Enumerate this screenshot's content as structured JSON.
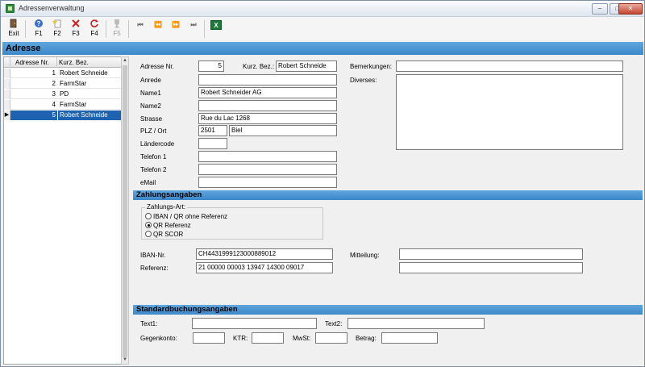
{
  "window": {
    "title": "Adressenverwaltung",
    "controls": {
      "minimize": "–",
      "maximize": "□",
      "close": "✕"
    }
  },
  "toolbar": {
    "exit_label": "Exit",
    "f1_label": "F1",
    "f2_label": "F2",
    "f3_label": "F3",
    "f4_label": "F4",
    "f5_label": "F5",
    "icons": {
      "exit": "exit-door-icon",
      "f1": "help-icon",
      "f2": "new-icon",
      "f3": "delete-icon",
      "f4": "refresh-icon",
      "f5": "trophy-icon",
      "first": "first-record-icon",
      "prev": "previous-record-icon",
      "next": "next-record-icon",
      "last": "last-record-icon",
      "excel": "excel-icon"
    },
    "nav_glyphs": {
      "first": "⏮",
      "prev": "⏪",
      "next": "⏩",
      "last": "⏭",
      "excel": "X"
    }
  },
  "section_title": "Adresse",
  "grid": {
    "columns": [
      "Adresse Nr.",
      "Kurz. Bez."
    ],
    "rows": [
      {
        "nr": "1",
        "bez": "Robert Schneide",
        "selected": false
      },
      {
        "nr": "2",
        "bez": "FarmStar",
        "selected": false
      },
      {
        "nr": "3",
        "bez": "PD",
        "selected": false
      },
      {
        "nr": "4",
        "bez": "FarmStar",
        "selected": false
      },
      {
        "nr": "5",
        "bez": "Robert Schneide",
        "selected": true
      }
    ],
    "row_pointer": "▶"
  },
  "address": {
    "nr_label": "Adresse Nr.",
    "nr_value": "5",
    "kurz_label": "Kurz. Bez.:",
    "kurz_value": "Robert Schneide",
    "anrede_label": "Anrede",
    "anrede_value": "",
    "name1_label": "Name1",
    "name1_value": "Robert Schneider AG",
    "name2_label": "Name2",
    "name2_value": "",
    "strasse_label": "Strasse",
    "strasse_value": "Rue du Lac 1268",
    "plz_label": "PLZ / Ort",
    "plz_value": "2501",
    "ort_value": "Biel",
    "land_label": "Ländercode",
    "land_value": "",
    "tel1_label": "Telefon 1",
    "tel1_value": "",
    "tel2_label": "Telefon 2",
    "tel2_value": "",
    "email_label": "eMail",
    "email_value": "",
    "bemerkungen_label": "Bemerkungen:",
    "bemerkungen_value": "",
    "diverses_label": "Diverses:",
    "diverses_value": ""
  },
  "payment": {
    "header": "Zahlungsangaben",
    "group_label": "Zahlungs-Art:",
    "options": [
      {
        "label": "IBAN / QR ohne Referenz",
        "checked": false
      },
      {
        "label": "QR Referenz",
        "checked": true
      },
      {
        "label": "QR SCOR",
        "checked": false
      }
    ],
    "iban_label": "IBAN-Nr.",
    "iban_value": "CH4431999123000889012",
    "referenz_label": "Referenz:",
    "referenz_value": "21 00000 00003 13947 14300 09017",
    "mitteilung_label": "Mitteilung:",
    "mitteilung_value": "",
    "mitteilung2_value": ""
  },
  "booking": {
    "header": "Standardbuchungsangaben",
    "text1_label": "Text1:",
    "text1_value": "",
    "text2_label": "Text2:",
    "text2_value": "",
    "gegenkonto_label": "Gegenkonto:",
    "gegenkonto_value": "",
    "ktr_label": "KTR:",
    "ktr_value": "",
    "mwst_label": "MwSt:",
    "mwst_value": "",
    "betrag_label": "Betrag:",
    "betrag_value": ""
  }
}
